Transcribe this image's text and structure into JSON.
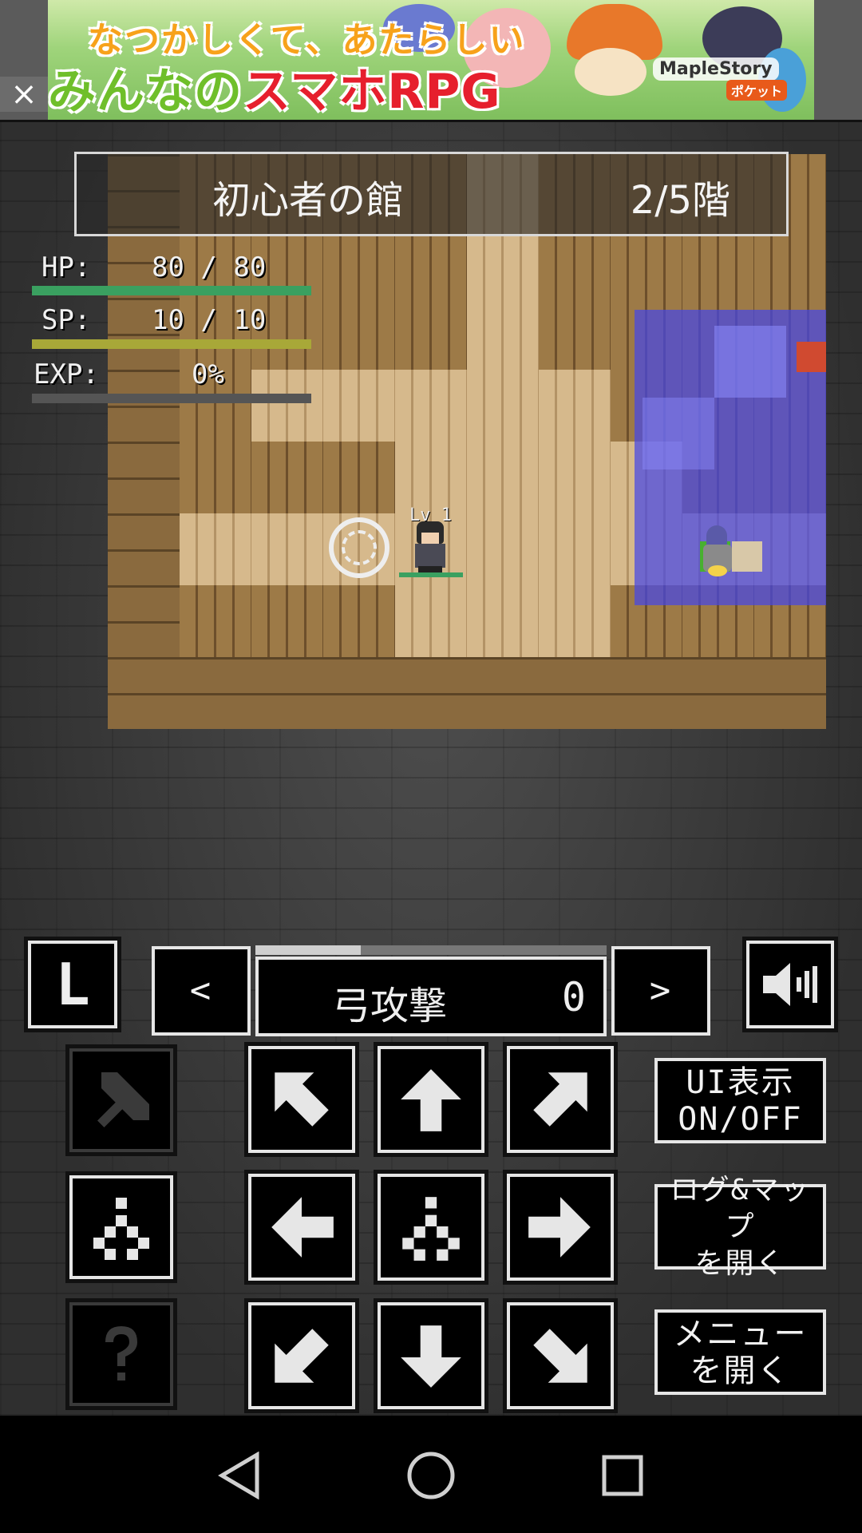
{
  "ad": {
    "close_glyph": "×",
    "line1": "なつかしくて、あたらしい",
    "line2_prefix": "みんなの",
    "line2_main": "スマホRPG",
    "brand": "MapleStory",
    "brand_sub": "ポケット"
  },
  "hud": {
    "dungeon_name": "初心者の館",
    "floor": "2/5階",
    "hp_label": "HP:",
    "hp_value": "80 / 80",
    "hp_fraction": 1.0,
    "sp_label": "SP:",
    "sp_value": "10 / 10",
    "sp_fraction": 1.0,
    "exp_label": "EXP:",
    "exp_value": "0%",
    "exp_fraction": 0.0,
    "colors": {
      "hp": "#3aa060",
      "sp": "#a8a838",
      "exp": "#7a7a7a",
      "room": "#4646e6"
    }
  },
  "map": {
    "player_level": "Lv 1"
  },
  "controls": {
    "log_button": "L",
    "prev_skill": "<",
    "next_skill": ">",
    "skill_name": "弓攻撃",
    "skill_count": "0",
    "skill_progress": 0.3,
    "ui_toggle": "UI表示\nON/OFF",
    "log_map": "ログ&マップ\nを開く",
    "menu": "メニュー\nを開く"
  },
  "icons": {
    "sound": "speaker-icon",
    "attack": "sword-icon",
    "wait": "wait-icon",
    "help": "question-icon",
    "arrows": [
      "arrow-up-left-icon",
      "arrow-up-icon",
      "arrow-up-right-icon",
      "arrow-left-icon",
      "wait-center-icon",
      "arrow-right-icon",
      "arrow-down-left-icon",
      "arrow-down-icon",
      "arrow-down-right-icon"
    ]
  }
}
